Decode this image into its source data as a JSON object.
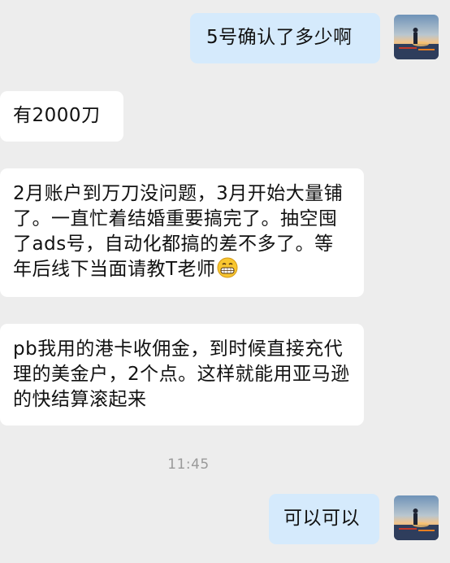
{
  "messages": [
    {
      "side": "out",
      "text": "5号确认了多少啊"
    },
    {
      "side": "in",
      "text": "有2000刀"
    },
    {
      "side": "in",
      "text": "2月账户到万刀没问题，3月开始大量铺了。一直忙着结婚重要搞完了。抽空囤了ads号，自动化都搞的差不多了。等年后线下当面请教T老师",
      "emoji": "grinning-face-emoji"
    },
    {
      "side": "in",
      "text": "pb我用的港卡收佣金，到时候直接充代理的美金户，2个点。这样就能用亚马逊的快结算滚起来"
    },
    {
      "side": "out",
      "text": "可以可以"
    }
  ],
  "timestamp": "11:45",
  "colors": {
    "background": "#ededed",
    "incoming_bubble": "#ffffff",
    "outgoing_bubble": "#d5eafc",
    "timestamp_text": "#9a9a9a"
  }
}
